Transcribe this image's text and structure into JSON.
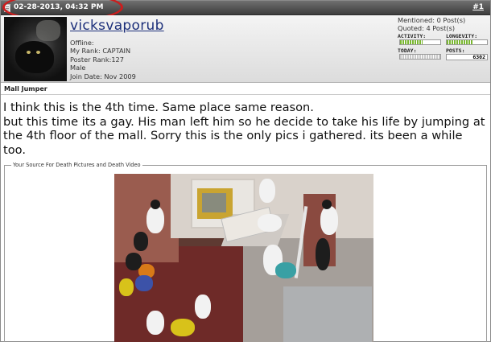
{
  "post": {
    "date": "02-28-2013, 04:32 PM",
    "number": "#1"
  },
  "user": {
    "username": "vicksvaporub",
    "status": "Offline:",
    "rank": "My Rank: CAPTAIN",
    "poster_rank": "Poster Rank:127",
    "gender": "Male",
    "join_date": "Join Date: Nov 2009"
  },
  "stats": {
    "mentioned": "Mentioned: 0 Post(s)",
    "quoted": "Quoted: 4 Post(s)",
    "activity_label": "ACTIVITY:",
    "longevity_label": "LONGEVITY:",
    "today_label": "TODAY:",
    "posts_label": "POSTS:",
    "posts_value": "6302",
    "activity_level": 0.55,
    "longevity_level": 0.65,
    "today_level": 0.0
  },
  "message": {
    "title": "Mall Jumper",
    "body_line1": "I think this is the 4th time. Same place same reason.",
    "body_line2": "but this time its a gay. His man left him so he decide to take his life by jumping at the 4th floor of the mall. Sorry this is the only pics i gathered. its been a while too.",
    "source_legend": "Your Source For Death Pictures and Death Video"
  },
  "colors": {
    "header": "#4a4a4a",
    "username": "#1c2f7a",
    "highlight_circle": "#cc1d1d",
    "bar_fill": "#7ab830"
  }
}
